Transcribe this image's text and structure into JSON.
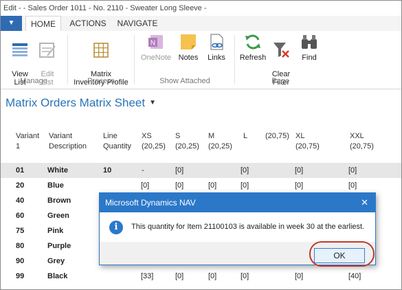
{
  "window": {
    "title": "Edit -  - Sales Order 1011 - No. 2110 - Sweater Long Sleeve -"
  },
  "ribbon": {
    "tabs": [
      "HOME",
      "ACTIONS",
      "NAVIGATE"
    ],
    "buttons": {
      "view_list": "View\nList",
      "edit_list": "Edit\nList",
      "matrix_inventory_profile": "Matrix\nInventory Profile",
      "onenote": "OneNote",
      "notes": "Notes",
      "links": "Links",
      "refresh": "Refresh",
      "clear_filter": "Clear\nFilter",
      "find": "Find"
    },
    "groups": [
      "Manage",
      "Process",
      "Show Attached",
      "Page"
    ]
  },
  "page": {
    "title": "Matrix Orders Matrix Sheet"
  },
  "grid": {
    "columns": [
      {
        "line1": "Variant",
        "line2": "1"
      },
      {
        "line1": "Variant",
        "line2": "Description"
      },
      {
        "line1": "Line",
        "line2": "Quantity"
      },
      {
        "line1": "XS",
        "line2": "(20,25)"
      },
      {
        "line1": "S",
        "line2": "(20,25)"
      },
      {
        "line1": "M",
        "line2": "(20,25)"
      },
      {
        "line1": "L",
        "line2": ""
      },
      {
        "line1": "(20,75)",
        "line2": ""
      },
      {
        "line1": "XL",
        "line2": "(20,75)"
      },
      {
        "line1": "XXL",
        "line2": "(20,75)"
      }
    ],
    "rows": [
      {
        "variant": "01",
        "desc": "White",
        "qty": "10",
        "xs": "-",
        "s": "[0]",
        "m": "",
        "l": "[0]",
        "xl": "[0]",
        "xxl": "[0]"
      },
      {
        "variant": "20",
        "desc": "Blue",
        "qty": "",
        "xs": "[0]",
        "s": "[0]",
        "m": "[0]",
        "l": "[0]",
        "xl": "[0]",
        "xxl": "[0]"
      },
      {
        "variant": "40",
        "desc": "Brown",
        "qty": "",
        "xs": "",
        "s": "",
        "m": "",
        "l": "",
        "xl": "",
        "xxl": ""
      },
      {
        "variant": "60",
        "desc": "Green",
        "qty": "",
        "xs": "",
        "s": "",
        "m": "",
        "l": "",
        "xl": "",
        "xxl": ""
      },
      {
        "variant": "75",
        "desc": "Pink",
        "qty": "",
        "xs": "",
        "s": "",
        "m": "",
        "l": "",
        "xl": "",
        "xxl": ""
      },
      {
        "variant": "80",
        "desc": "Purple",
        "qty": "",
        "xs": "",
        "s": "",
        "m": "",
        "l": "",
        "xl": "",
        "xxl": ""
      },
      {
        "variant": "90",
        "desc": "Grey",
        "qty": "",
        "xs": "",
        "s": "",
        "m": "",
        "l": "",
        "xl": "",
        "xxl": ""
      },
      {
        "variant": "99",
        "desc": "Black",
        "qty": "",
        "xs": "[33]",
        "s": "[0]",
        "m": "[0]",
        "l": "[0]",
        "xl": "[0]",
        "xxl": "[40]"
      }
    ]
  },
  "dialog": {
    "title": "Microsoft Dynamics NAV",
    "message": "This quantity for Item 21100103 is available in week 30 at the earliest.",
    "ok_label": "OK"
  },
  "colors": {
    "accent": "#2b78c9",
    "title_blue": "#2a74b8",
    "highlight_ring": "#c0392b",
    "selected_row": "#e6e6e6"
  }
}
